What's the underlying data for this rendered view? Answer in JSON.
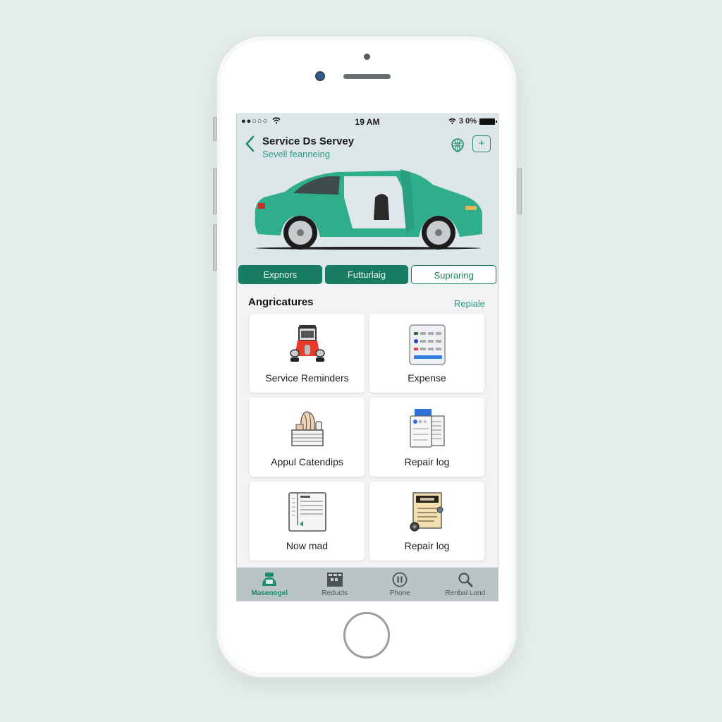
{
  "device": {
    "type": "smartphone"
  },
  "status_bar": {
    "signal": "●●○○○",
    "time": "19 AM",
    "battery_text": "3 0%"
  },
  "header": {
    "back_icon": "chevron-left-icon",
    "title": "Service Ds Servey",
    "subtitle": "Sevell feanneing",
    "actions": [
      {
        "icon": "globe-shield-icon"
      },
      {
        "icon": "plus-icon",
        "label": "+"
      }
    ]
  },
  "hero": {
    "image": "green-sedan-door-open",
    "car_color": "#2fae8c"
  },
  "tabs": [
    {
      "label": "Expnors",
      "active": true
    },
    {
      "label": "Futturlaig",
      "active": true
    },
    {
      "label": "Supraring",
      "active": false
    }
  ],
  "section": {
    "title": "Angricatures",
    "link": "Repiale"
  },
  "cards": [
    {
      "label": "Service Reminders",
      "icon": "vintage-car-icon"
    },
    {
      "label": "Expense",
      "icon": "expense-sheet-icon"
    },
    {
      "label": "Appul Catendips",
      "icon": "supplies-basket-icon"
    },
    {
      "label": "Repair log",
      "icon": "documents-icon"
    },
    {
      "label": "Now mad",
      "icon": "notebook-icon"
    },
    {
      "label": "Repair log",
      "icon": "receipt-icon"
    }
  ],
  "bottom_nav": [
    {
      "label": "Masenogel",
      "icon": "garage-icon",
      "active": true
    },
    {
      "label": "Reducts",
      "icon": "grid-box-icon",
      "active": false
    },
    {
      "label": "Phone",
      "icon": "pause-circle-icon",
      "active": false
    },
    {
      "label": "Renbal Lond",
      "icon": "search-icon",
      "active": false
    }
  ],
  "colors": {
    "accent": "#177c62",
    "accent_text": "#2a9a82",
    "background": "#e4ecec"
  }
}
